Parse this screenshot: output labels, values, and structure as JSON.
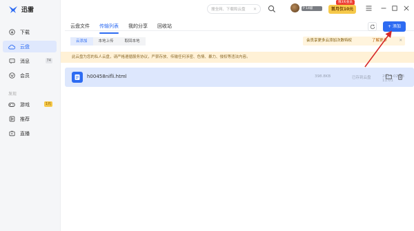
{
  "app": {
    "name": "迅雷"
  },
  "sidebar": {
    "items": [
      {
        "label": "下载",
        "icon": "download-icon"
      },
      {
        "label": "云盘",
        "icon": "cloud-icon",
        "active": true
      },
      {
        "label": "消息",
        "icon": "message-icon",
        "badge": "74"
      },
      {
        "label": "会员",
        "icon": "member-icon"
      }
    ],
    "section_label": "发现",
    "discover": [
      {
        "label": "游戏",
        "icon": "game-icon",
        "badge": "1元"
      },
      {
        "label": "推荐",
        "icon": "recommend-icon"
      },
      {
        "label": "直播",
        "icon": "live-icon"
      }
    ]
  },
  "header": {
    "search_placeholder": "搜全网、下载和云盘",
    "user_tag": "P 14级",
    "vip_label": "首月仅10元",
    "vip_ribbon": "限3天会员"
  },
  "tabs": [
    {
      "label": "云盘文件"
    },
    {
      "label": "传输列表",
      "active": true
    },
    {
      "label": "我的分享"
    },
    {
      "label": "回收站"
    }
  ],
  "subtabs": [
    {
      "label": "云添加",
      "active": true
    },
    {
      "label": "本地上传"
    },
    {
      "label": "取回本地"
    }
  ],
  "toolbar": {
    "add_label": "+ 添加"
  },
  "promo": {
    "text": "会员享更多云添加次数特权",
    "link": "了解更多",
    "close": "✕"
  },
  "notice": {
    "text": "此云盘为您的私人云盘，请严格遵循服务协议，严禁存放、传输任何涉密、色情、暴力、侵权等违法内容。"
  },
  "file": {
    "name": "h00458nifli.html",
    "size": "398.8KB",
    "status": "已存到云盘",
    "date": "2023-02-03 11:01"
  },
  "colors": {
    "accent": "#2d6bf2",
    "vip": "#f6c94a",
    "notice_bg": "#fff1d6",
    "row_bg": "#dde7fd"
  }
}
